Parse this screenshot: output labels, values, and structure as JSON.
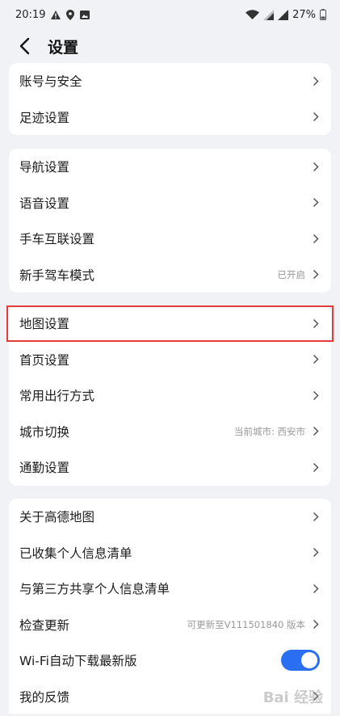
{
  "status": {
    "time": "20:19",
    "battery": "27%"
  },
  "header": {
    "title": "设置"
  },
  "group1": [
    {
      "label": "账号与安全"
    },
    {
      "label": "足迹设置"
    }
  ],
  "group2": [
    {
      "label": "导航设置"
    },
    {
      "label": "语音设置"
    },
    {
      "label": "手车互联设置"
    },
    {
      "label": "新手驾车模式",
      "value": "已开启"
    }
  ],
  "group3": [
    {
      "label": "地图设置"
    },
    {
      "label": "首页设置"
    },
    {
      "label": "常用出行方式"
    },
    {
      "label": "城市切换",
      "value": "当前城市: 西安市"
    },
    {
      "label": "通勤设置"
    }
  ],
  "group4": [
    {
      "label": "关于高德地图"
    },
    {
      "label": "已收集个人信息清单"
    },
    {
      "label": "与第三方共享个人信息清单"
    },
    {
      "label": "检查更新",
      "value": "可更新至V111501840 版本"
    },
    {
      "label": "Wi-Fi自动下载最新版",
      "toggle": true
    },
    {
      "label": "我的反馈"
    }
  ],
  "colors": {
    "accent": "#2a6ff2",
    "highlight": "#e43b3b",
    "background": "#f1f2f6"
  },
  "watermark": "Bai 经验"
}
